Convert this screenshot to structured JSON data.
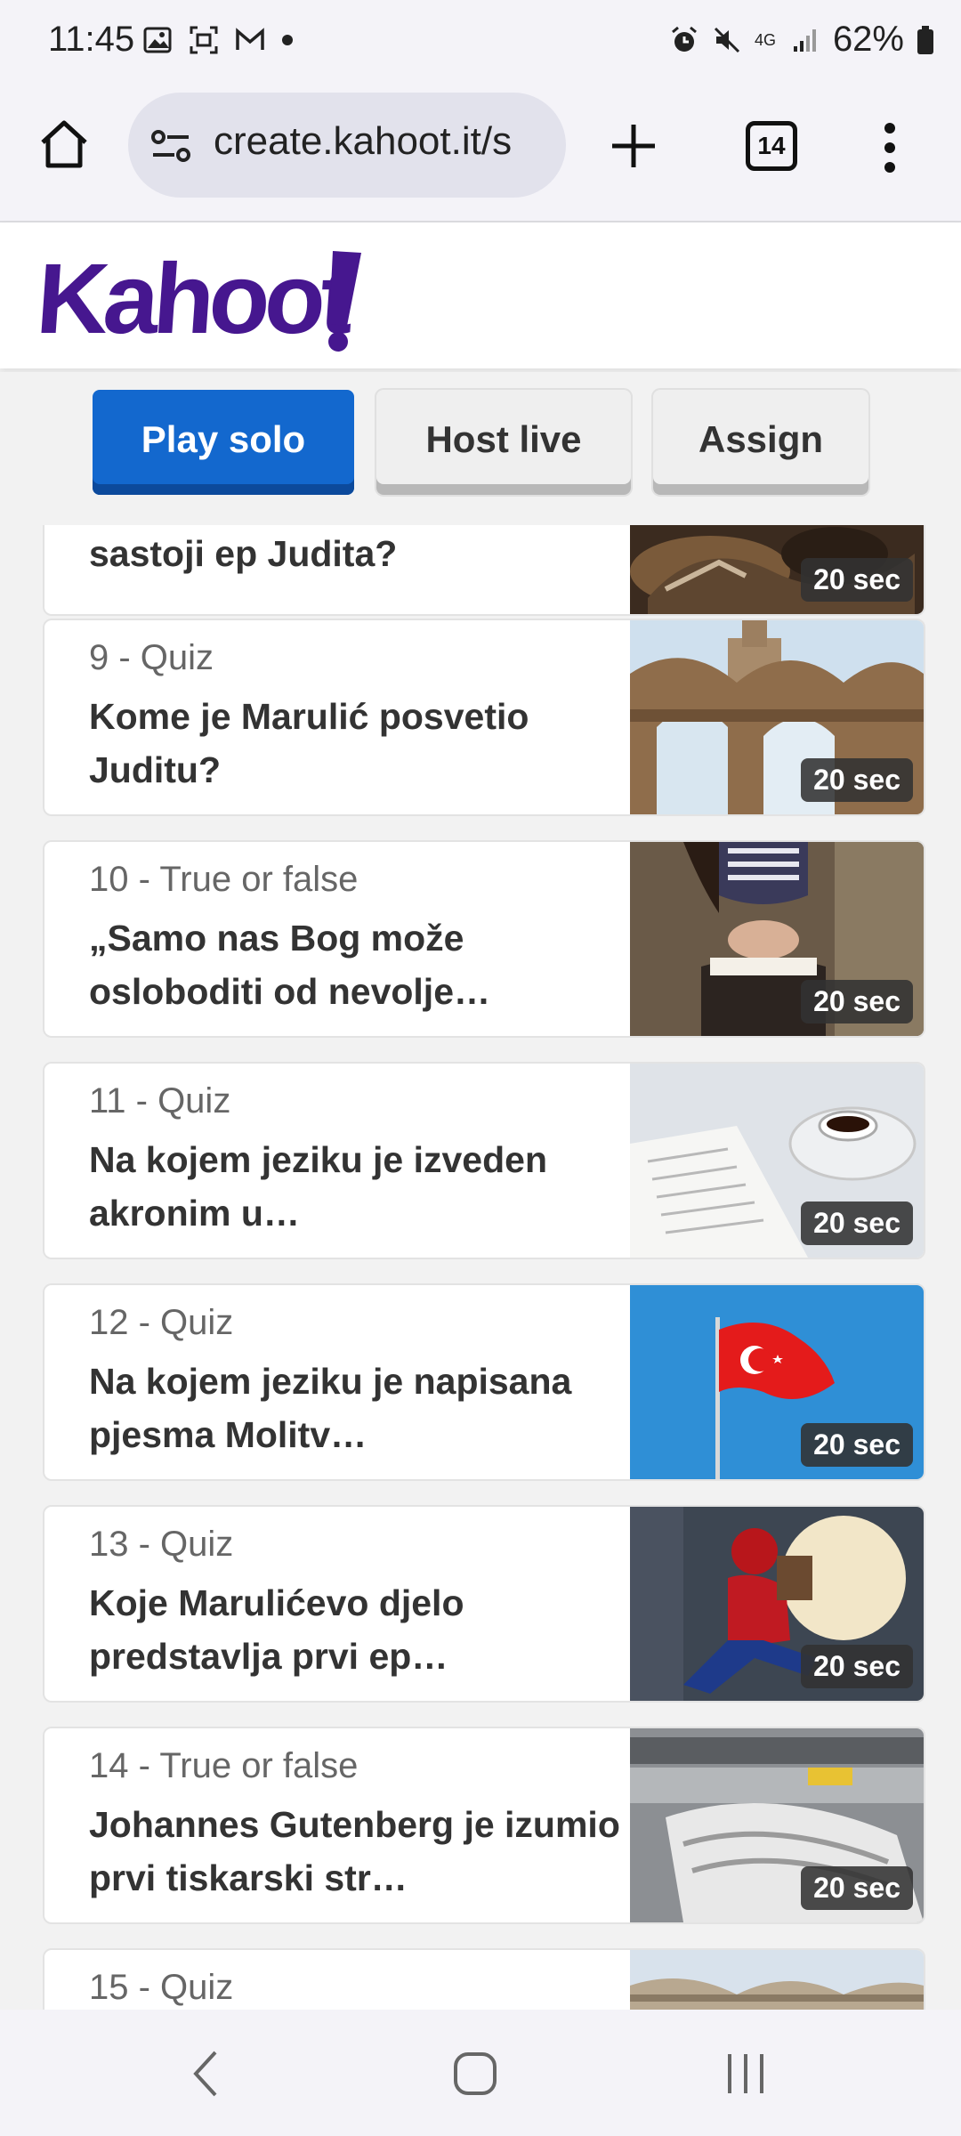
{
  "status_bar": {
    "time": "11:45",
    "network": "4G",
    "battery": "62%"
  },
  "browser": {
    "url": "create.kahoot.it/s",
    "tab_count": "14"
  },
  "brand": {
    "logo": "Kahoot!",
    "color": "#46178f"
  },
  "actions": {
    "play_solo": "Play solo",
    "host_live": "Host live",
    "assign": "Assign"
  },
  "questions": [
    {
      "meta": "",
      "title": "sastoji ep Judita?",
      "time": "20 sec",
      "image": "painting"
    },
    {
      "meta": "9 - Quiz",
      "title": "Kome je Marulić posvetio Juditu?",
      "time": "20 sec",
      "image": "arches"
    },
    {
      "meta": "10 - True or false",
      "title": "„Samo nas Bog može osloboditi od nevolje…",
      "time": "20 sec",
      "image": "praying"
    },
    {
      "meta": "11 - Quiz",
      "title": "Na kojem jeziku je izveden akronim u…",
      "time": "20 sec",
      "image": "book-coffee"
    },
    {
      "meta": "12 - Quiz",
      "title": "Na kojem jeziku je napisana pjesma Molitv…",
      "time": "20 sec",
      "image": "flag"
    },
    {
      "meta": "13 - Quiz",
      "title": "Koje Marulićevo djelo predstavlja prvi ep…",
      "time": "20 sec",
      "image": "spiderman"
    },
    {
      "meta": "14 - True or false",
      "title": "Johannes Gutenberg je izumio prvi tiskarski str…",
      "time": "20 sec",
      "image": "printing-press"
    },
    {
      "meta": "15 - Quiz",
      "title": "",
      "time": "",
      "image": "palace"
    }
  ]
}
